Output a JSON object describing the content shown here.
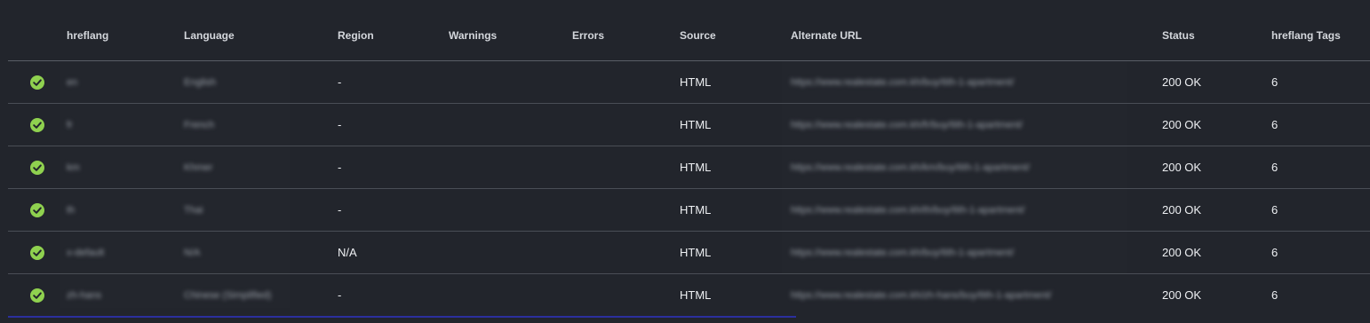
{
  "columns": {
    "hreflang": "hreflang",
    "language": "Language",
    "region": "Region",
    "warnings": "Warnings",
    "errors": "Errors",
    "source": "Source",
    "alternate_url": "Alternate URL",
    "status": "Status",
    "hreflang_tags": "hreflang Tags"
  },
  "rows": [
    {
      "hreflang": "en",
      "language": "English",
      "region": "-",
      "warnings": "",
      "errors": "",
      "source": "HTML",
      "alternate_url": "https://www.realestate.com.kh/buy/6th-1-apartment/",
      "status": "200 OK",
      "hreflang_tags": "6"
    },
    {
      "hreflang": "fr",
      "language": "French",
      "region": "-",
      "warnings": "",
      "errors": "",
      "source": "HTML",
      "alternate_url": "https://www.realestate.com.kh/fr/buy/6th-1-apartment/",
      "status": "200 OK",
      "hreflang_tags": "6"
    },
    {
      "hreflang": "km",
      "language": "Khmer",
      "region": "-",
      "warnings": "",
      "errors": "",
      "source": "HTML",
      "alternate_url": "https://www.realestate.com.kh/km/buy/6th-1-apartment/",
      "status": "200 OK",
      "hreflang_tags": "6"
    },
    {
      "hreflang": "th",
      "language": "Thai",
      "region": "-",
      "warnings": "",
      "errors": "",
      "source": "HTML",
      "alternate_url": "https://www.realestate.com.kh/th/buy/6th-1-apartment/",
      "status": "200 OK",
      "hreflang_tags": "6"
    },
    {
      "hreflang": "x-default",
      "language": "N/A",
      "region": "N/A",
      "warnings": "",
      "errors": "",
      "source": "HTML",
      "alternate_url": "https://www.realestate.com.kh/buy/6th-1-apartment/",
      "status": "200 OK",
      "hreflang_tags": "6"
    },
    {
      "hreflang": "zh-hans",
      "language": "Chinese (Simplified)",
      "region": "-",
      "warnings": "",
      "errors": "",
      "source": "HTML",
      "alternate_url": "https://www.realestate.com.kh/zh-hans/buy/6th-1-apartment/",
      "status": "200 OK",
      "hreflang_tags": "6"
    }
  ],
  "icons": {
    "row_status": "check-circle-icon"
  },
  "colors": {
    "background": "#22252c",
    "check": "#8fd14f",
    "accent": "#2b2f9e"
  }
}
